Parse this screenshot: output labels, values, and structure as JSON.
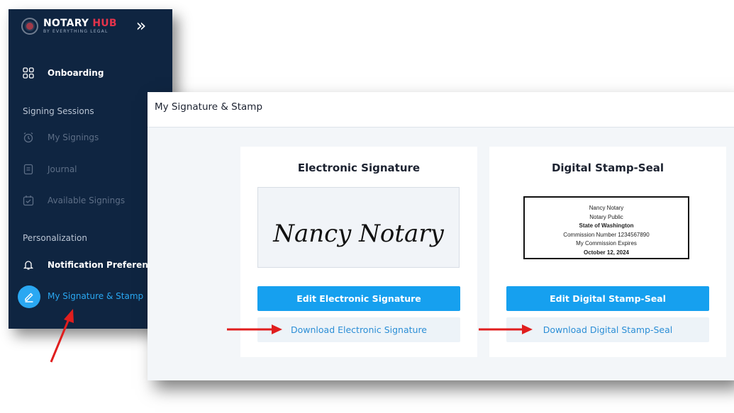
{
  "sidebar": {
    "logo": {
      "name": "NOTARY",
      "accent": "HUB",
      "tagline": "BY EVERYTHING LEGAL"
    },
    "collapse_glyph": "»",
    "onboarding": "Onboarding",
    "sections": [
      {
        "label": "Signing Sessions",
        "items": [
          "My Signings",
          "Journal",
          "Available Signings"
        ]
      },
      {
        "label": "Personalization",
        "items": [
          "Notification Preferences",
          "My Signature & Stamp"
        ]
      }
    ],
    "icons": {
      "onboarding": "grid-icon",
      "my_signings": "alarm-clock-icon",
      "journal": "journal-icon",
      "available": "calendar-check-icon",
      "notifications": "bell-icon",
      "signature": "pen-icon"
    }
  },
  "panel": {
    "title": "My Signature & Stamp",
    "signature_card": {
      "title": "Electronic Signature",
      "signature_text": "Nancy Notary",
      "edit_label": "Edit Electronic Signature",
      "download_label": "Download Electronic Signature"
    },
    "stamp_card": {
      "title": "Digital Stamp-Seal",
      "stamp_lines": [
        "Nancy Notary",
        "Notary Public",
        "State of Washington",
        "Commission Number 1234567890",
        "My Commission Expires",
        "October 12, 2024"
      ],
      "edit_label": "Edit Digital Stamp-Seal",
      "download_label": "Download Digital Stamp-Seal"
    }
  },
  "colors": {
    "sidebar_bg": "#0f2541",
    "accent_blue": "#16a0ef",
    "logo_red": "#e5334b",
    "arrow_red": "#e01e1e"
  }
}
